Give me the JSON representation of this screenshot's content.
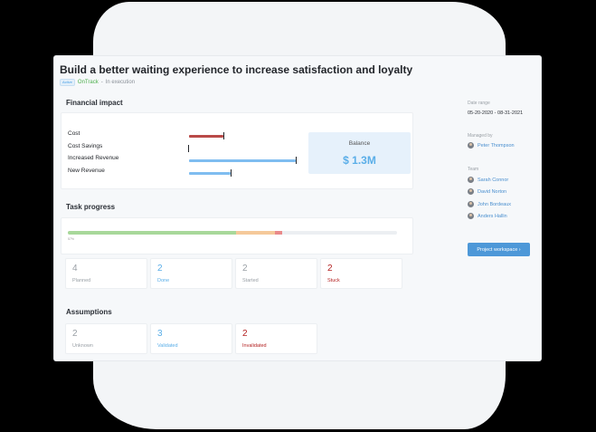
{
  "header": {
    "title": "Build a better waiting experience to increase satisfaction and loyalty",
    "badge": "Active",
    "status": "OnTrack",
    "separator": "-",
    "execution": "In execution"
  },
  "financial": {
    "heading": "Financial impact",
    "rows": [
      {
        "label": "Cost",
        "color": "#b94a48"
      },
      {
        "label": "Cost Savings",
        "color": "#23262b"
      },
      {
        "label": "Increased Revenue",
        "color": "#7fbdf0"
      },
      {
        "label": "New Revenue",
        "color": "#7fbdf0"
      }
    ],
    "balance_label": "Balance",
    "balance_value": "$ 1.3M"
  },
  "task_progress": {
    "heading": "Task progress",
    "percent_text": "57%",
    "segments": [
      {
        "name": "done",
        "fraction": 0.51,
        "color": "#a8d89a"
      },
      {
        "name": "started",
        "fraction": 0.12,
        "color": "#f5c99a"
      },
      {
        "name": "stuck",
        "fraction": 0.02,
        "color": "#e98a8a"
      }
    ],
    "stats": [
      {
        "value": "4",
        "label": "Planned",
        "color": "gray"
      },
      {
        "value": "2",
        "label": "Done",
        "color": "blue"
      },
      {
        "value": "2",
        "label": "Started",
        "color": "gray"
      },
      {
        "value": "2",
        "label": "Stuck",
        "color": "red"
      }
    ]
  },
  "assumptions": {
    "heading": "Assumptions",
    "stats": [
      {
        "value": "2",
        "label": "Unknown",
        "color": "gray"
      },
      {
        "value": "3",
        "label": "Validated",
        "color": "blue"
      },
      {
        "value": "2",
        "label": "Invalidated",
        "color": "red"
      }
    ]
  },
  "sidebar": {
    "date_range_label": "Date range",
    "date_range_value": "05-20-2020 - 08-31-2021",
    "managed_by_label": "Managed by",
    "manager": "Peter Thompson",
    "team_label": "Team",
    "team": [
      "Sarah Connor",
      "David Norton",
      "John Bordeaux",
      "Anders Hallin"
    ],
    "button": "Project workspace ›"
  }
}
